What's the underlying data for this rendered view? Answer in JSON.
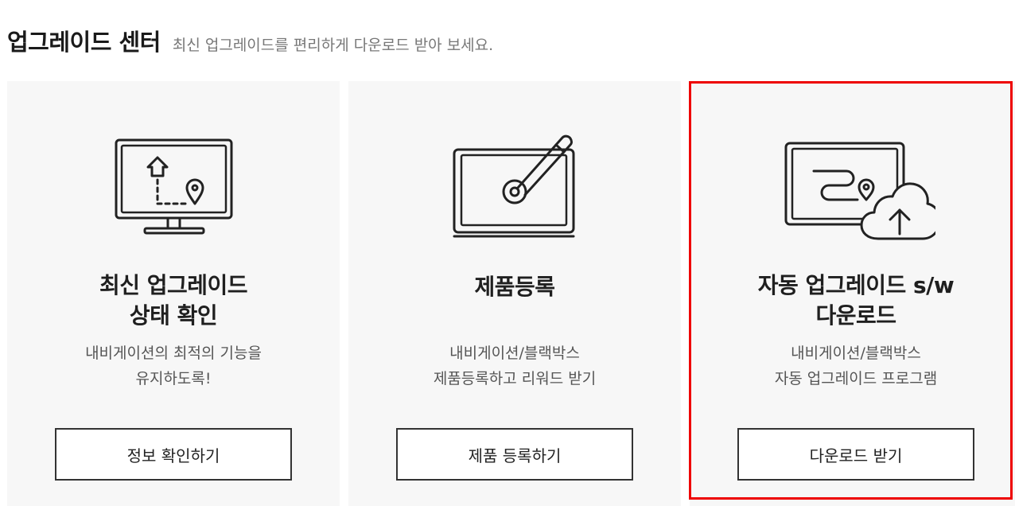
{
  "header": {
    "title": "업그레이드 센터",
    "subtitle": "최신 업그레이드를 편리하게 다운로드 받아 보세요."
  },
  "cards": [
    {
      "icon": "monitor-route-icon",
      "title_lines": [
        "최신 업그레이드",
        "상태 확인"
      ],
      "desc_lines": [
        "내비게이션의 최적의 기능을",
        "유지하도록!"
      ],
      "button_label": "정보 확인하기"
    },
    {
      "icon": "tablet-pen-icon",
      "title_lines": [
        "제품등록"
      ],
      "desc_lines": [
        "내비게이션/블랙박스",
        "제품등록하고 리워드 받기"
      ],
      "button_label": "제품 등록하기"
    },
    {
      "icon": "cloud-upload-icon",
      "title_lines": [
        "자동 업그레이드 s/w",
        "다운로드"
      ],
      "desc_lines": [
        "내비게이션/블랙박스",
        "자동 업그레이드 프로그램"
      ],
      "button_label": "다운로드 받기"
    }
  ],
  "colors": {
    "card_background": "#f7f7f7",
    "highlight_border": "#ee0000",
    "button_border": "#333333"
  }
}
